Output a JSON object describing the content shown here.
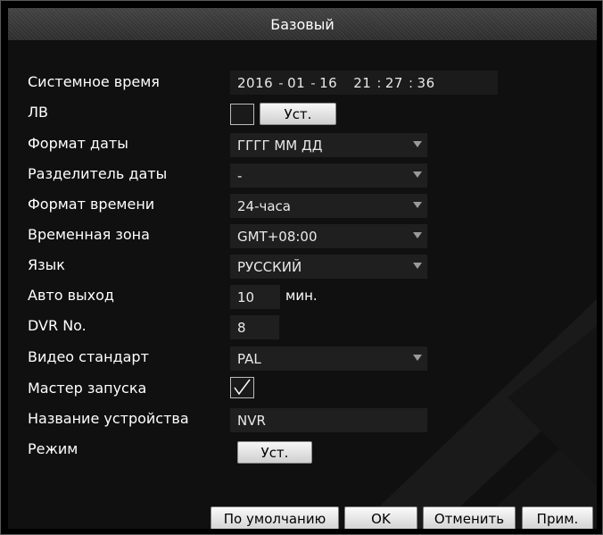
{
  "dialog": {
    "title": "Базовый"
  },
  "fields": {
    "system_time": {
      "label": "Системное время",
      "year": "2016",
      "month": "01",
      "day": "16",
      "hour": "21",
      "minute": "27",
      "second": "36",
      "date_separator": "-",
      "time_separator": ":"
    },
    "dst": {
      "label": "ЛВ",
      "checked": false,
      "button_label": "Уст."
    },
    "date_format": {
      "label": "Формат даты",
      "value": "ГГГГ ММ ДД"
    },
    "date_separator": {
      "label": "Разделитель даты",
      "value": "-"
    },
    "time_format": {
      "label": "Формат времени",
      "value": "24-часа"
    },
    "time_zone": {
      "label": "Временная зона",
      "value": "GMT+08:00"
    },
    "language": {
      "label": "Язык",
      "value": "РУССКИЙ"
    },
    "auto_logout": {
      "label": "Авто выход",
      "value": "10",
      "unit": "мин."
    },
    "dvr_no": {
      "label": "DVR No.",
      "value": "8"
    },
    "video_standard": {
      "label": "Видео стандарт",
      "value": "PAL"
    },
    "startup_wizard": {
      "label": "Мастер запуска",
      "checked": true
    },
    "device_name": {
      "label": "Название устройства",
      "value": "NVR"
    },
    "mode": {
      "label": "Режим",
      "button_label": "Уст."
    }
  },
  "footer": {
    "default_label": "По умолчанию",
    "ok_label": "OK",
    "cancel_label": "Отменить",
    "apply_label": "Прим."
  },
  "colors": {
    "background": "#000000",
    "field": "#1f1f1f",
    "button": "#e0e0e0"
  }
}
